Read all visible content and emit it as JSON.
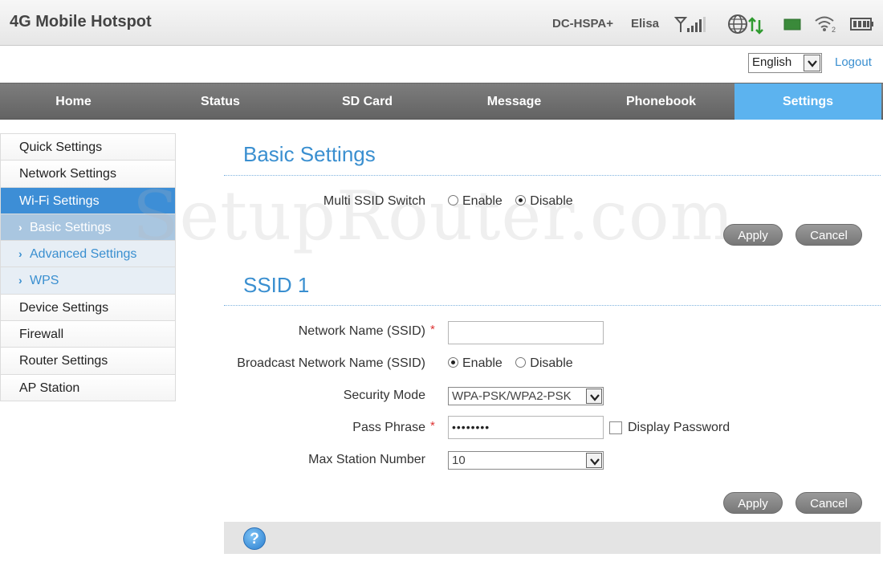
{
  "header": {
    "title": "4G Mobile Hotspot",
    "network_type": "DC-HSPA+",
    "carrier": "Elisa",
    "status_icons": [
      "signal-strength-icon",
      "roaming-globe-icon",
      "data-transfer-icon",
      "sim-card-icon",
      "wifi-icon",
      "battery-icon"
    ],
    "wifi_clients": "2"
  },
  "language": {
    "selected": "English"
  },
  "logout_label": "Logout",
  "nav": {
    "tabs": [
      {
        "label": "Home"
      },
      {
        "label": "Status"
      },
      {
        "label": "SD Card"
      },
      {
        "label": "Message"
      },
      {
        "label": "Phonebook"
      },
      {
        "label": "Settings",
        "active": true
      }
    ]
  },
  "sidebar": {
    "items": [
      {
        "label": "Quick Settings"
      },
      {
        "label": "Network Settings"
      },
      {
        "label": "Wi-Fi Settings",
        "active": true
      },
      {
        "label": "Basic Settings",
        "sub": true,
        "current": true
      },
      {
        "label": "Advanced Settings",
        "sub": true
      },
      {
        "label": "WPS",
        "sub": true
      },
      {
        "label": "Device Settings"
      },
      {
        "label": "Firewall"
      },
      {
        "label": "Router Settings"
      },
      {
        "label": "AP Station"
      }
    ]
  },
  "watermark": "SetupRouter.com",
  "basic": {
    "title": "Basic Settings",
    "multi_ssid_label": "Multi SSID Switch",
    "enable_label": "Enable",
    "disable_label": "Disable",
    "multi_ssid_value": "Disable",
    "apply_label": "Apply",
    "cancel_label": "Cancel"
  },
  "ssid1": {
    "title": "SSID 1",
    "network_name_label": "Network Name (SSID)",
    "network_name_value": "",
    "required_mark": "*",
    "broadcast_label": "Broadcast Network Name (SSID)",
    "enable_label": "Enable",
    "disable_label": "Disable",
    "broadcast_value": "Enable",
    "security_mode_label": "Security Mode",
    "security_mode_value": "WPA-PSK/WPA2-PSK",
    "pass_phrase_label": "Pass Phrase",
    "pass_phrase_value": "••••••••",
    "display_password_label": "Display Password",
    "display_password_checked": false,
    "max_station_label": "Max Station Number",
    "max_station_value": "10",
    "apply_label": "Apply",
    "cancel_label": "Cancel"
  },
  "colors": {
    "accent": "#3a8fd0",
    "nav_active": "#5cb3ef",
    "nav_bg": "#6e6e6e",
    "sidebar_active": "#3d8ed6",
    "status_green": "#2f9a2f"
  }
}
